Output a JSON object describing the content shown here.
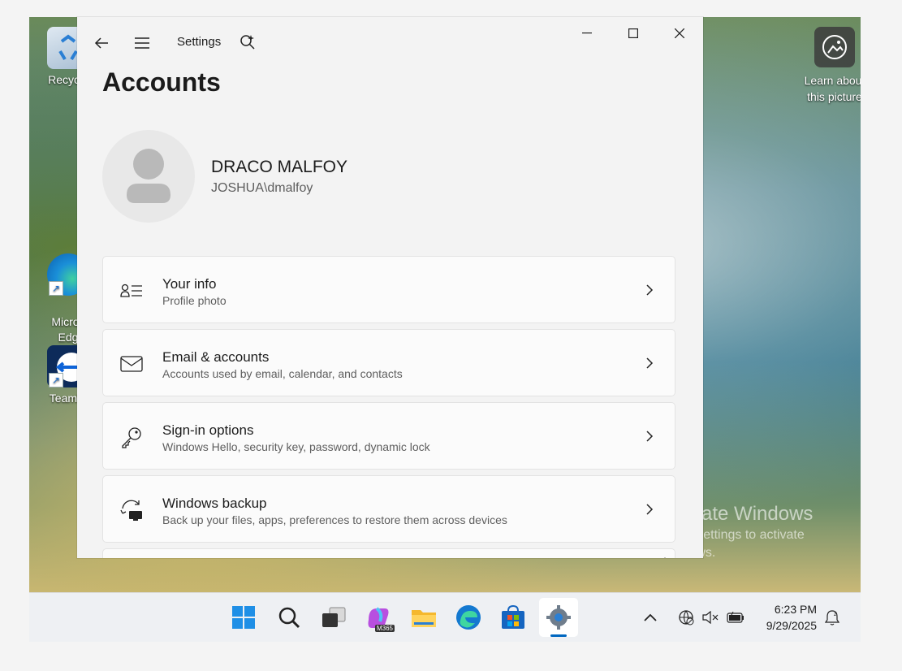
{
  "desktop": {
    "icons": [
      {
        "label": "Recycle"
      },
      {
        "label": "Micros\nEdg"
      },
      {
        "label": "TeamVi"
      }
    ],
    "spotlight": {
      "label_line1": "Learn about",
      "label_line2": "this picture"
    },
    "watermark": {
      "title": "Activate Windows",
      "subtitle": "Go to Settings to activate",
      "subtitle2": "Windows."
    }
  },
  "window": {
    "title": "Settings",
    "page_title": "Accounts",
    "user": {
      "name": "DRACO MALFOY",
      "account": "JOSHUA\\dmalfoy"
    },
    "cards": [
      {
        "title": "Your info",
        "subtitle": "Profile photo",
        "icon": "person-list-icon"
      },
      {
        "title": "Email & accounts",
        "subtitle": "Accounts used by email, calendar, and contacts",
        "icon": "mail-icon"
      },
      {
        "title": "Sign-in options",
        "subtitle": "Windows Hello, security key, password, dynamic lock",
        "icon": "key-icon"
      },
      {
        "title": "Windows backup",
        "subtitle": "Back up your files, apps, preferences to restore them across devices",
        "icon": "backup-icon"
      }
    ]
  },
  "taskbar": {
    "apps": [
      "start-icon",
      "search-icon",
      "task-view-icon",
      "m365-copilot-icon",
      "file-explorer-icon",
      "edge-icon",
      "store-icon",
      "settings-icon"
    ],
    "m365_badge": "M365",
    "clock": {
      "time": "6:23 PM",
      "date": "9/29/2025"
    }
  },
  "colors": {
    "accent": "#0067c0",
    "window_bg": "#f3f3f3",
    "card_bg": "#fbfbfb"
  }
}
